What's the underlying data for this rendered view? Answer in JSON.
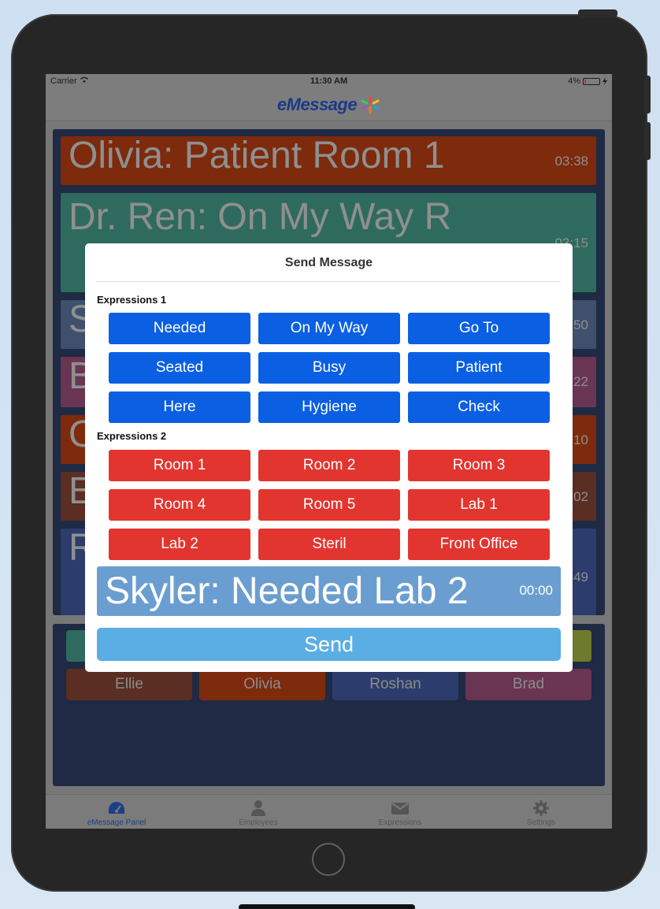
{
  "status_bar": {
    "carrier": "Carrier",
    "time": "11:30 AM",
    "battery": "4%"
  },
  "app": {
    "logo_text": "eMessage"
  },
  "messages": [
    {
      "text": "Olivia: Patient Room 1",
      "time": "03:38",
      "color": "#7e2a0c"
    },
    {
      "text": "Dr. Ren: On My Way R",
      "time": "03:15",
      "color": "#2e6b5e"
    },
    {
      "text": "S",
      "time": "50",
      "color": "#3e506e"
    },
    {
      "text": "B",
      "time": "22",
      "color": "#6a3553"
    },
    {
      "text": "O",
      "time": "10",
      "color": "#7e2a0c"
    },
    {
      "text": "E",
      "time": "02",
      "color": "#5a2e22"
    },
    {
      "text": "R",
      "time": "49",
      "color": "#2c3c6c"
    }
  ],
  "employees": [
    "Ellie",
    "Olivia",
    "Roshan",
    "Brad"
  ],
  "tabs": [
    {
      "label": "eMessage Panel",
      "icon": "dashboard-icon",
      "active": true
    },
    {
      "label": "Employees",
      "icon": "person-icon",
      "active": false
    },
    {
      "label": "Expressions",
      "icon": "envelope-icon",
      "active": false
    },
    {
      "label": "Settings",
      "icon": "gear-icon",
      "active": false
    }
  ],
  "modal": {
    "title": "Send Message",
    "section1_label": "Expressions 1",
    "section1": [
      "Needed",
      "On My Way",
      "Go To",
      "Seated",
      "Busy",
      "Patient",
      "Here",
      "Hygiene",
      "Check"
    ],
    "section2_label": "Expressions 2",
    "section2": [
      "Room 1",
      "Room 2",
      "Room 3",
      "Room 4",
      "Room 5",
      "Lab 1",
      "Lab 2",
      "Steril",
      "Front Office"
    ],
    "preview_text": "Skyler: Needed Lab 2",
    "preview_time": "00:00",
    "send_label": "Send"
  },
  "colors": {
    "expr1": "#0a5fe3",
    "expr2": "#e2352f",
    "preview": "#6b9ed0",
    "send": "#5aaee3"
  }
}
